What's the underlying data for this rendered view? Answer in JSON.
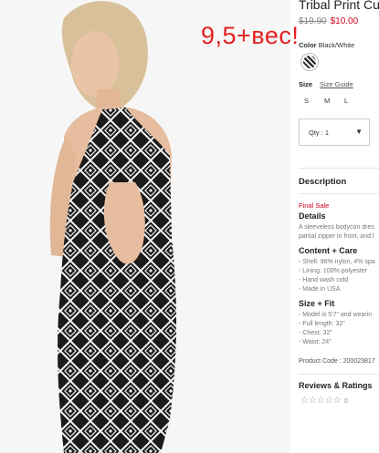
{
  "overlay_text": "9,5+вес!",
  "product": {
    "title": "Tribal Print Cu",
    "old_price": "$19.90",
    "new_price": "$10.00",
    "color_label": "Color",
    "color_value": "Black/White",
    "size_label": "Size",
    "size_guide": "Size Guide",
    "sizes": [
      "S",
      "M",
      "L"
    ],
    "qty_label": "Qty : 1",
    "qty_caret": "▼"
  },
  "description": {
    "heading": "Description",
    "final_sale": "Final Sale",
    "details_heading": "Details",
    "details_lines": [
      "A sleeveless bodycon dres",
      "partial zipper in front, and l"
    ],
    "content_heading": "Content + Care",
    "content_lines": [
      "- Shell: 96% nylon, 4% spa",
      "- Lining: 100% polyester",
      "- Hand wash cold",
      "- Made in USA"
    ],
    "fit_heading": "Size + Fit",
    "fit_lines": [
      "- Model is 5'7\" and wearin",
      "- Full length: 32\"",
      "- Chest: 32\"",
      "- Waist: 24\""
    ],
    "product_code": "Product Code : 200023817"
  },
  "reviews": {
    "heading": "Reviews & Ratings",
    "stars": "☆☆☆☆☆",
    "count": "0",
    "rating": 0
  },
  "colors": {
    "accent_red": "#d0021b",
    "overlay_red": "#e32020"
  }
}
